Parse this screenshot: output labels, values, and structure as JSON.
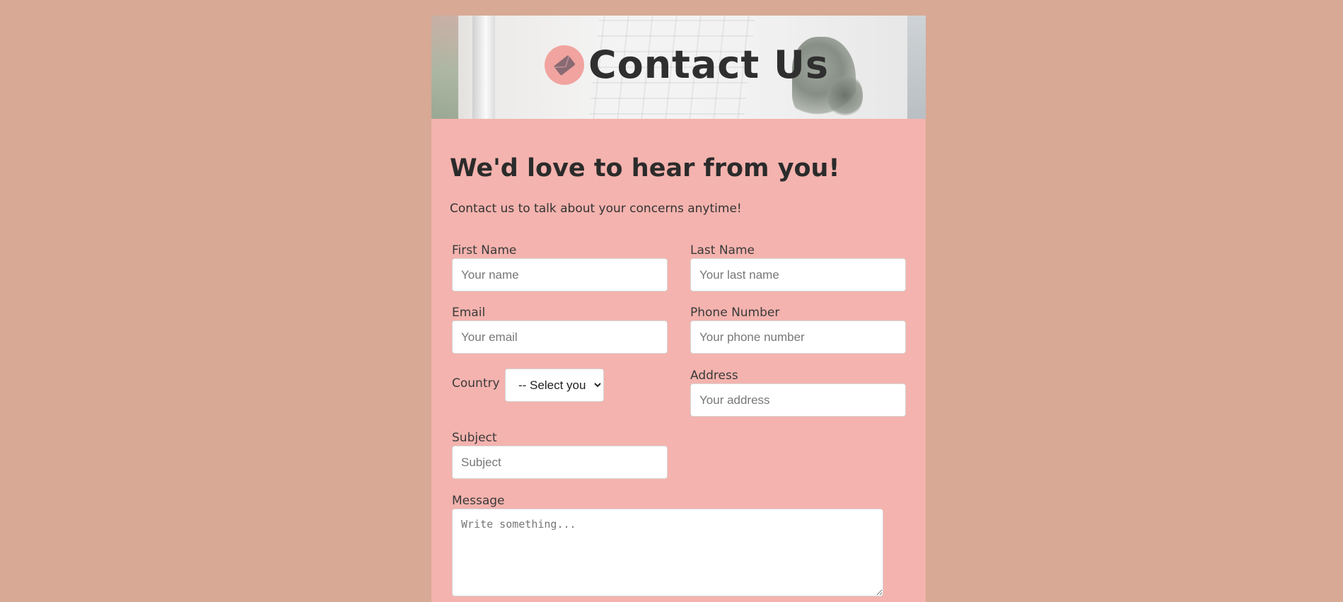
{
  "header": {
    "title": "Contact Us",
    "icon": "envelope-icon"
  },
  "intro": {
    "heading": "We'd love to hear from you!",
    "subtext": "Contact us to talk about your concerns anytime!"
  },
  "form": {
    "first_name": {
      "label": "First Name",
      "placeholder": "Your name"
    },
    "last_name": {
      "label": "Last Name",
      "placeholder": "Your last name"
    },
    "email": {
      "label": "Email",
      "placeholder": "Your email"
    },
    "phone": {
      "label": "Phone Number",
      "placeholder": "Your phone number"
    },
    "country": {
      "label": "Country",
      "selected": "-- Select your"
    },
    "address": {
      "label": "Address",
      "placeholder": "Your address"
    },
    "subject": {
      "label": "Subject",
      "placeholder": "Subject"
    },
    "message": {
      "label": "Message",
      "placeholder": "Write something..."
    }
  },
  "colors": {
    "page_background": "#d8a994",
    "card_background": "#f4b3ae",
    "icon_circle": "#f1a49f",
    "heading_text": "#2b2b2b"
  }
}
